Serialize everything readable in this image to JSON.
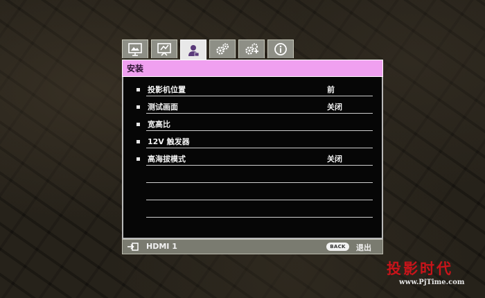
{
  "tabs": [
    {
      "icon": "picture-icon",
      "active": false
    },
    {
      "icon": "display-icon",
      "active": false
    },
    {
      "icon": "installation-icon",
      "active": true
    },
    {
      "icon": "system-settings-icon",
      "active": false
    },
    {
      "icon": "advanced-settings-icon",
      "active": false
    },
    {
      "icon": "information-icon",
      "active": false
    }
  ],
  "menu": {
    "title": "安装",
    "items": [
      {
        "label": "投影机位置",
        "value": "前"
      },
      {
        "label": "测试画面",
        "value": "关闭"
      },
      {
        "label": "宽高比",
        "value": ""
      },
      {
        "label": "12V 触发器",
        "value": ""
      },
      {
        "label": "高海拔模式",
        "value": "关闭"
      },
      {
        "label": "",
        "value": ""
      },
      {
        "label": "",
        "value": ""
      },
      {
        "label": "",
        "value": ""
      }
    ]
  },
  "footer": {
    "source_icon": "input-source-icon",
    "source_label": "HDMI 1",
    "back_button": "BACK",
    "exit_label": "退出"
  },
  "watermark": {
    "cn": "投影时代",
    "en": "www.PjTime.com"
  },
  "colors": {
    "title_bar": "#f0a0f0",
    "panel_bg": "#060606",
    "footer_bg": "#7a7b70",
    "tab_bg": "#8e8f86",
    "watermark_red": "#c8141a"
  }
}
